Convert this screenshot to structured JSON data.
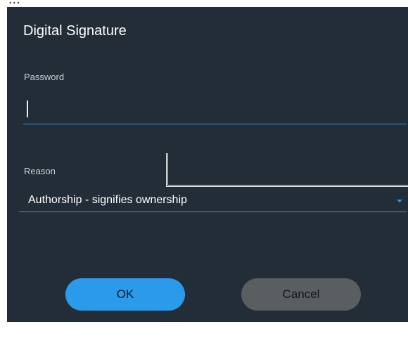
{
  "top_strip_text": "...",
  "dialog": {
    "title": "Digital Signature",
    "password": {
      "label": "Password",
      "value": ""
    },
    "reason": {
      "label": "Reason",
      "selected": "Authorship - signifies ownership"
    },
    "buttons": {
      "ok": "OK",
      "cancel": "Cancel"
    }
  },
  "colors": {
    "dialog_background": "#222d37",
    "accent": "#2e9be8",
    "ok_button": "#2a9bea",
    "cancel_button": "#5b5e61"
  },
  "icons": {
    "dropdown": "caret-down-icon",
    "resize": "resize-handle"
  }
}
